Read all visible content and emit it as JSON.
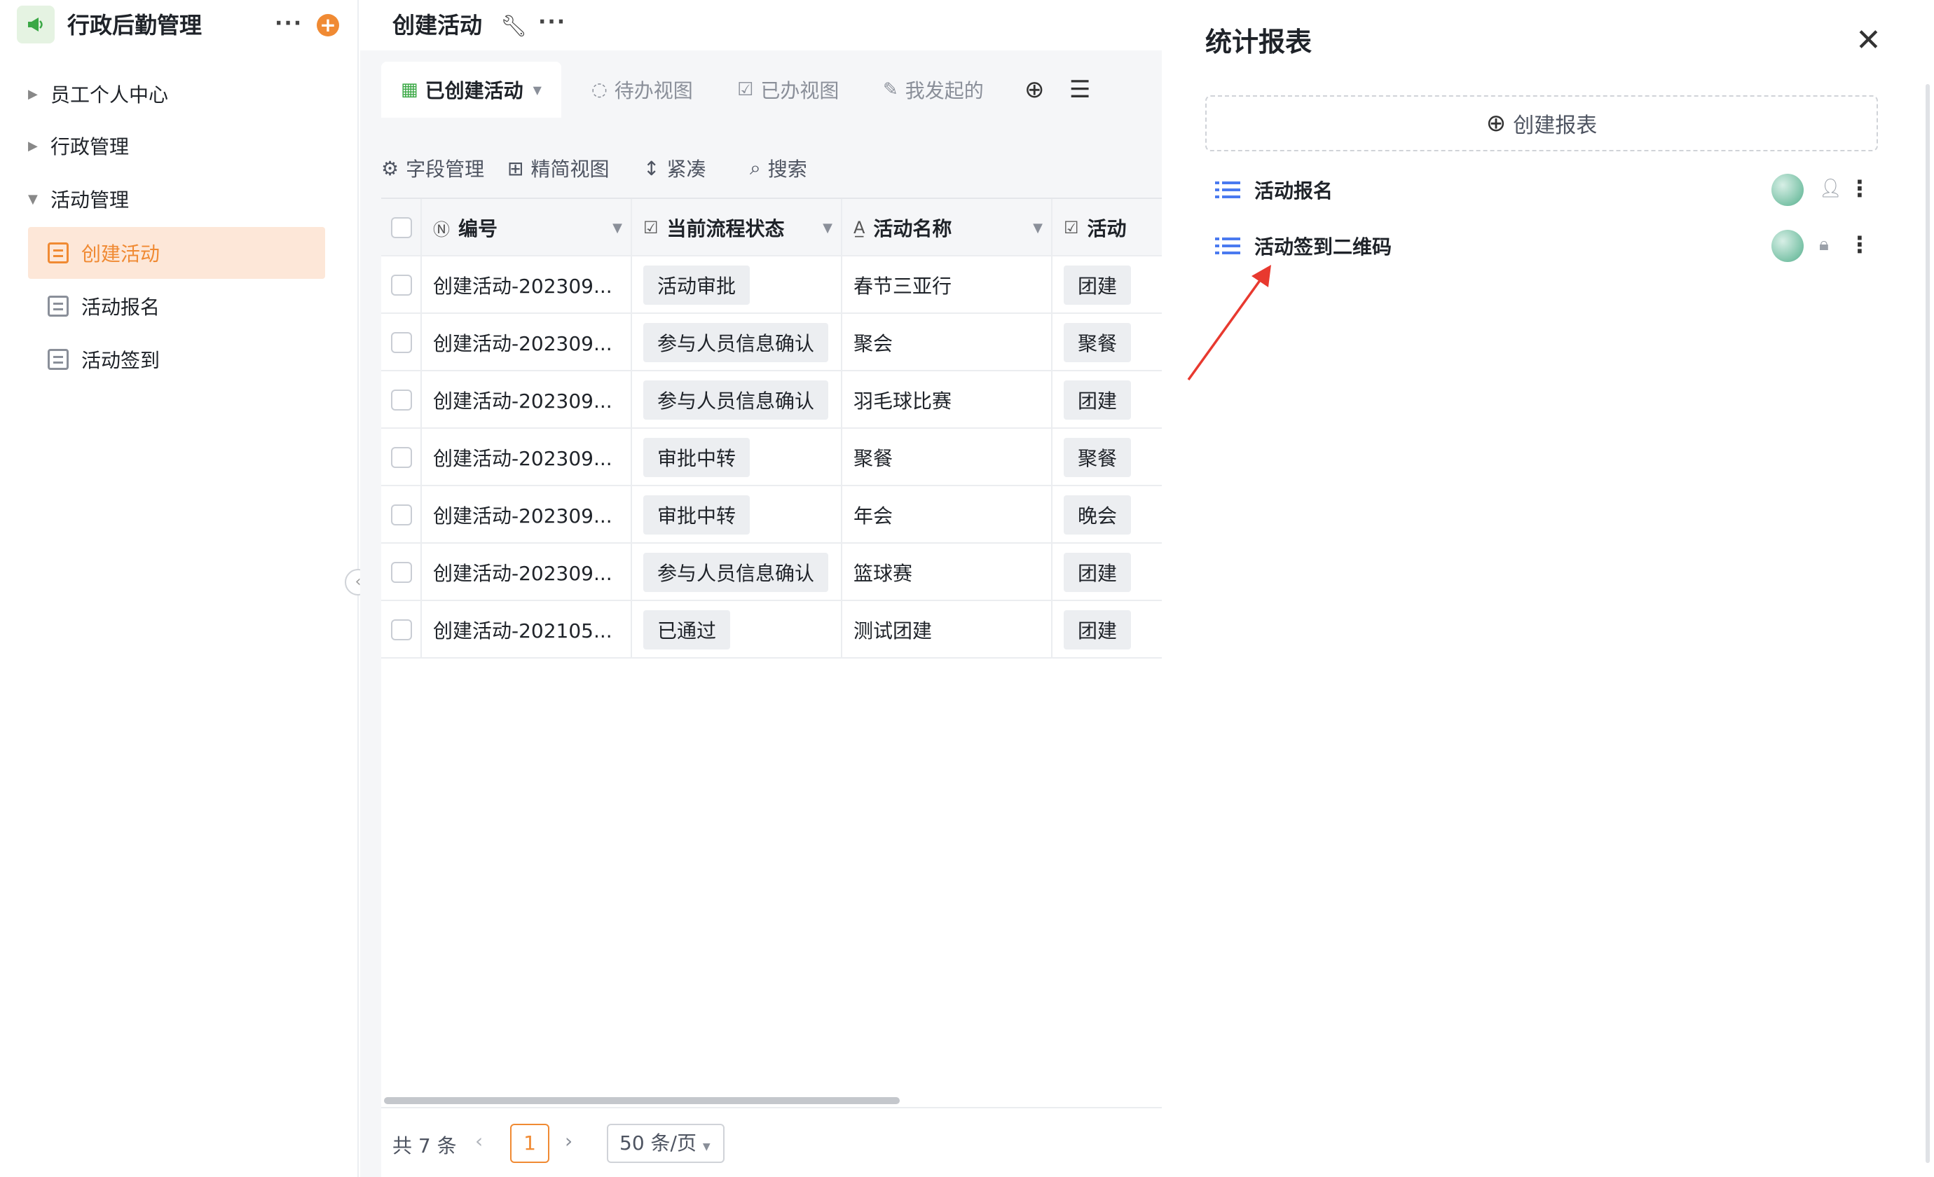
{
  "sidebar": {
    "app_title": "行政后勤管理",
    "more_label": "···",
    "add_label": "+",
    "groups": [
      {
        "label": "员工个人中心",
        "expanded": false
      },
      {
        "label": "行政管理",
        "expanded": false
      },
      {
        "label": "活动管理",
        "expanded": true
      }
    ],
    "sub_items": [
      {
        "label": "创建活动",
        "active": true
      },
      {
        "label": "活动报名",
        "active": false
      },
      {
        "label": "活动签到",
        "active": false
      }
    ]
  },
  "main": {
    "title": "创建活动",
    "more_label": "···",
    "tabs": [
      {
        "label": "已创建活动",
        "active": true
      },
      {
        "label": "待办视图",
        "active": false
      },
      {
        "label": "已办视图",
        "active": false
      },
      {
        "label": "我发起的",
        "active": false
      }
    ],
    "toolbar": {
      "fields": "字段管理",
      "compact_view": "精简视图",
      "row_height": "紧凑",
      "search": "搜索"
    },
    "table": {
      "columns": [
        "编号",
        "当前流程状态",
        "活动名称",
        "活动"
      ],
      "rows": [
        {
          "id": "创建活动-202309...",
          "status": "活动审批",
          "name": "春节三亚行",
          "type": "团建"
        },
        {
          "id": "创建活动-202309...",
          "status": "参与人员信息确认",
          "name": "聚会",
          "type": "聚餐"
        },
        {
          "id": "创建活动-202309...",
          "status": "参与人员信息确认",
          "name": "羽毛球比赛",
          "type": "团建"
        },
        {
          "id": "创建活动-202309...",
          "status": "审批中转",
          "name": "聚餐",
          "type": "聚餐"
        },
        {
          "id": "创建活动-202309...",
          "status": "审批中转",
          "name": "年会",
          "type": "晚会"
        },
        {
          "id": "创建活动-202309...",
          "status": "参与人员信息确认",
          "name": "篮球赛",
          "type": "团建"
        },
        {
          "id": "创建活动-202105...",
          "status": "已通过",
          "name": "测试团建",
          "type": "团建"
        }
      ]
    },
    "pagination": {
      "total": "共 7 条",
      "current_page": "1",
      "page_size": "50 条/页"
    }
  },
  "panel": {
    "title": "统计报表",
    "create_label": "创建报表",
    "reports": [
      {
        "name": "活动报名",
        "perm_icon": "user-icon"
      },
      {
        "name": "活动签到二维码",
        "perm_icon": "lock-icon"
      }
    ]
  },
  "colors": {
    "accent": "#f08a33",
    "active_bg": "#fde7d8",
    "list_icon": "#4a7af0",
    "annotation_arrow": "#e8392f"
  }
}
